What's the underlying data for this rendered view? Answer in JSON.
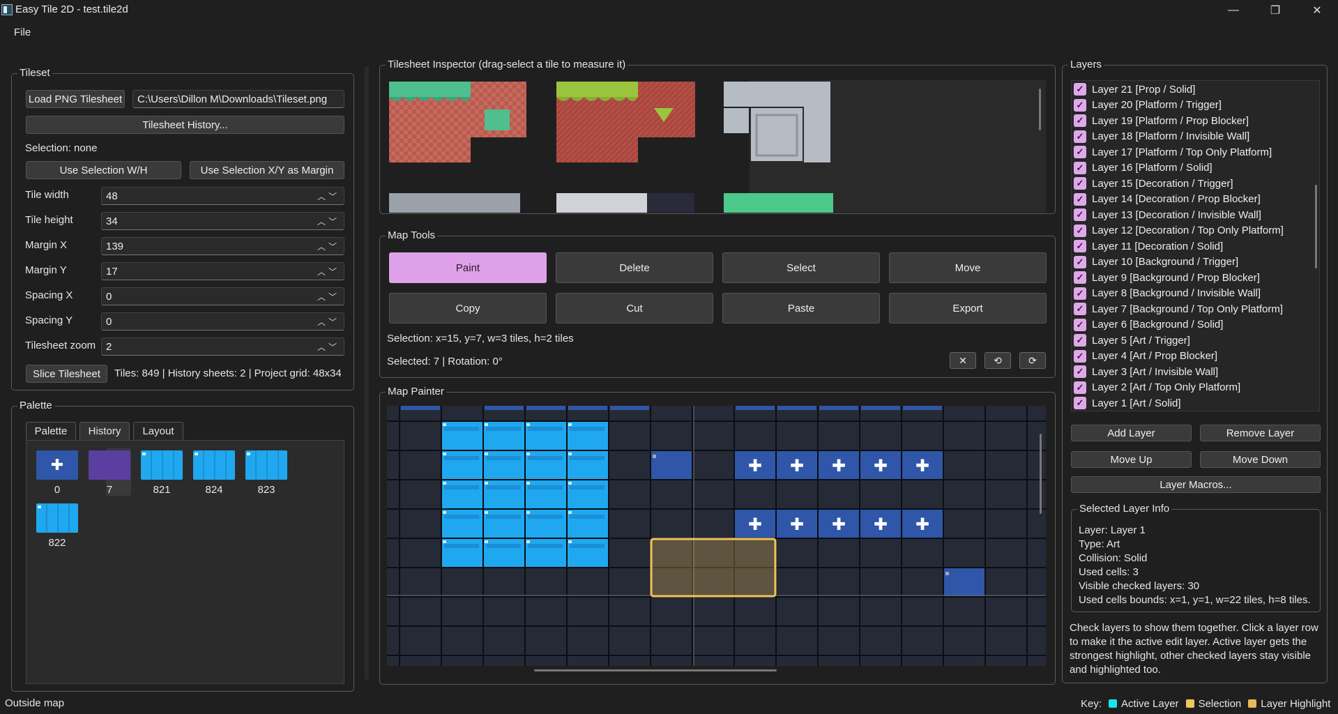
{
  "window": {
    "title": "Easy Tile 2D - test.tile2d",
    "minimize": "—",
    "maximize": "❐",
    "close": "✕"
  },
  "menu": {
    "file": "File"
  },
  "tileset": {
    "title": "Tileset",
    "load_button": "Load PNG Tilesheet",
    "path": "C:\\Users\\Dillon M\\Downloads\\Tileset.png",
    "history_button": "Tilesheet History...",
    "selection": "Selection: none",
    "use_wh_button": "Use Selection W/H",
    "use_xy_button": "Use Selection X/Y as Margin",
    "fields": [
      {
        "label": "Tile width",
        "value": "48"
      },
      {
        "label": "Tile height",
        "value": "34"
      },
      {
        "label": "Margin X",
        "value": "139"
      },
      {
        "label": "Margin Y",
        "value": "17"
      },
      {
        "label": "Spacing X",
        "value": "0"
      },
      {
        "label": "Spacing Y",
        "value": "0"
      },
      {
        "label": "Tilesheet zoom",
        "value": "2"
      }
    ],
    "slice_button": "Slice Tilesheet",
    "stats": "Tiles: 849  |  History sheets: 2  |  Project grid: 48x34"
  },
  "palette": {
    "title": "Palette",
    "tabs": [
      "Palette",
      "History",
      "Layout"
    ],
    "active_tab": "History",
    "tiles": [
      {
        "id": "0",
        "kind": "plus"
      },
      {
        "id": "7",
        "kind": "purple"
      },
      {
        "id": "821",
        "kind": "water"
      },
      {
        "id": "824",
        "kind": "water"
      },
      {
        "id": "823",
        "kind": "water"
      },
      {
        "id": "822",
        "kind": "water"
      }
    ]
  },
  "inspector": {
    "title": "Tilesheet Inspector (drag-select a tile to measure it)"
  },
  "tools": {
    "title": "Map Tools",
    "buttons": [
      "Paint",
      "Delete",
      "Select",
      "Move",
      "Copy",
      "Cut",
      "Paste",
      "Export"
    ],
    "active": "Paint",
    "selection": "Selection: x=15, y=7, w=3 tiles, h=2 tiles",
    "selected": "Selected: 7  |  Rotation: 0°",
    "clear_icon": "✕",
    "rotate_left_icon": "⟲",
    "rotate_right_icon": "⟳"
  },
  "painter": {
    "title": "Map Painter"
  },
  "layers": {
    "title": "Layers",
    "items": [
      "Layer 21  [Prop / Solid]",
      "Layer 20  [Platform / Trigger]",
      "Layer 19  [Platform / Prop Blocker]",
      "Layer 18  [Platform / Invisible Wall]",
      "Layer 17  [Platform / Top Only Platform]",
      "Layer 16  [Platform / Solid]",
      "Layer 15  [Decoration / Trigger]",
      "Layer 14  [Decoration / Prop Blocker]",
      "Layer 13  [Decoration / Invisible Wall]",
      "Layer 12  [Decoration / Top Only Platform]",
      "Layer 11  [Decoration / Solid]",
      "Layer 10  [Background / Trigger]",
      "Layer 9  [Background / Prop Blocker]",
      "Layer 8  [Background / Invisible Wall]",
      "Layer 7  [Background / Top Only Platform]",
      "Layer 6  [Background / Solid]",
      "Layer 5  [Art / Trigger]",
      "Layer 4  [Art / Prop Blocker]",
      "Layer 3  [Art / Invisible Wall]",
      "Layer 2  [Art / Top Only Platform]",
      "Layer 1  [Art / Solid]"
    ],
    "add": "Add Layer",
    "remove": "Remove Layer",
    "up": "Move Up",
    "down": "Move Down",
    "macros": "Layer Macros...",
    "info_title": "Selected Layer Info",
    "info": [
      "Layer: Layer 1",
      "Type: Art",
      "Collision: Solid",
      "Used cells: 3",
      "Visible checked layers: 30",
      "Used cells bounds: x=1, y=1, w=22 tiles, h=8 tiles."
    ],
    "help": [
      "Check layers to show them together. Click a layer row",
      "to make it the active edit layer. Active layer gets the",
      "strongest highlight, other checked layers stay visible",
      "and highlighted too."
    ]
  },
  "status": {
    "left": "Outside map",
    "key": "Key:",
    "items": [
      {
        "label": "Active Layer",
        "color": "#19e3e8"
      },
      {
        "label": "Selection",
        "color": "#f0c65a"
      },
      {
        "label": "Layer Highlight",
        "color": "#e9b85a"
      }
    ]
  },
  "colors": {
    "accent": "#dea0e8",
    "selection": "#f0c65a",
    "bg": "#1f1f1f"
  }
}
